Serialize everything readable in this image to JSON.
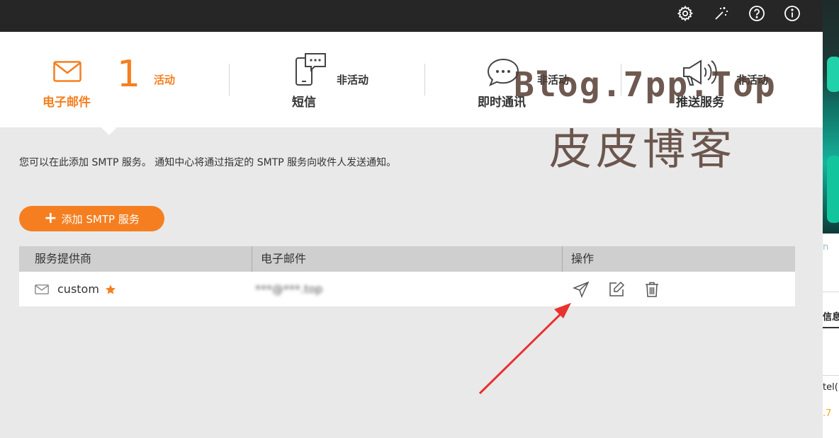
{
  "topbar": {
    "icons": [
      "gear-icon",
      "magic-wand-icon",
      "help-icon",
      "info-icon"
    ]
  },
  "tabs": [
    {
      "label": "电子邮件",
      "count": "1",
      "status": "活动",
      "icon": "envelope-icon",
      "active": true
    },
    {
      "label": "短信",
      "status": "非活动",
      "icon": "phone-chat-icon",
      "active": false
    },
    {
      "label": "即时通讯",
      "status": "非活动",
      "icon": "chat-bubble-icon",
      "active": false
    },
    {
      "label": "推送服务",
      "status": "非活动",
      "icon": "megaphone-icon",
      "active": false
    }
  ],
  "watermark": {
    "line1": "Blog.7pp.Top",
    "line2": "皮皮博客"
  },
  "description": "您可以在此添加 SMTP 服务。 通知中心将通过指定的 SMTP 服务向收件人发送通知。",
  "add_button": {
    "label": "添加 SMTP 服务"
  },
  "table": {
    "headers": [
      "服务提供商",
      "电子邮件",
      "操作"
    ],
    "rows": [
      {
        "provider": "custom",
        "default_star": true,
        "email": "***@***.top",
        "actions": [
          "send-test-icon",
          "edit-icon",
          "delete-icon"
        ]
      }
    ]
  },
  "right_strip": {
    "items": [
      "n",
      "信息",
      "tel(",
      ".7"
    ]
  },
  "colors": {
    "accent": "#f57f20",
    "topbar": "#262626",
    "annotation_arrow": "#e8322f"
  }
}
